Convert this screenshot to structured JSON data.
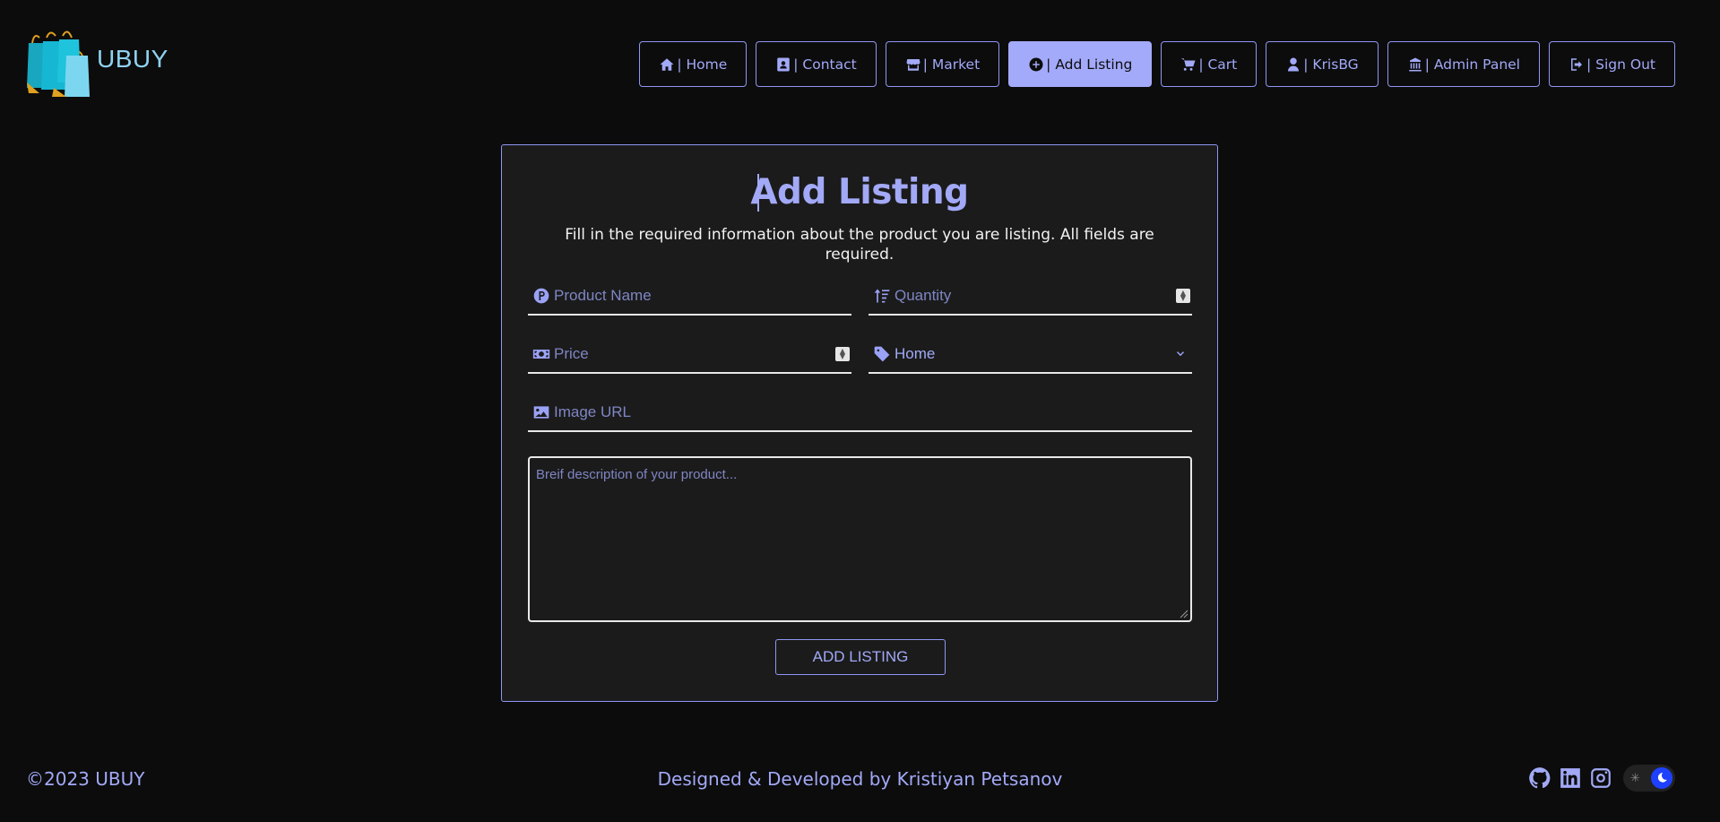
{
  "brand": {
    "name": "UBUY"
  },
  "nav": [
    {
      "label": "| Home",
      "icon": "home-icon"
    },
    {
      "label": "| Contact",
      "icon": "contact-card-icon"
    },
    {
      "label": "| Market",
      "icon": "store-icon"
    },
    {
      "label": "| Add Listing",
      "icon": "plus-circle-icon",
      "active": true
    },
    {
      "label": "| Cart",
      "icon": "cart-icon"
    },
    {
      "label": "| KrisBG",
      "icon": "user-icon"
    },
    {
      "label": "| Admin Panel",
      "icon": "admin-building-icon"
    },
    {
      "label": "| Sign Out",
      "icon": "sign-out-icon"
    }
  ],
  "form": {
    "title": "Add Listing",
    "subtitle": "Fill in the required information about the product you are listing. All fields are required.",
    "product_name": {
      "placeholder": "Product Name",
      "value": ""
    },
    "quantity": {
      "placeholder": "Quantity",
      "value": ""
    },
    "price": {
      "placeholder": "Price",
      "value": ""
    },
    "category": {
      "value": "Home"
    },
    "image_url": {
      "placeholder": "Image URL",
      "value": ""
    },
    "description": {
      "placeholder": "Breif description of your product...",
      "value": ""
    },
    "submit_label": "ADD LISTING"
  },
  "footer": {
    "copyright": "©2023 UBUY",
    "credit": "Designed & Developed by Kristiyan Petsanov",
    "socials": [
      "github-icon",
      "linkedin-icon",
      "instagram-icon"
    ],
    "theme": "dark"
  },
  "colors": {
    "accent": "#a4aafa",
    "background": "#0c0c0c",
    "card": "#1b1b1b",
    "toggle_knob": "#1e40ff"
  }
}
